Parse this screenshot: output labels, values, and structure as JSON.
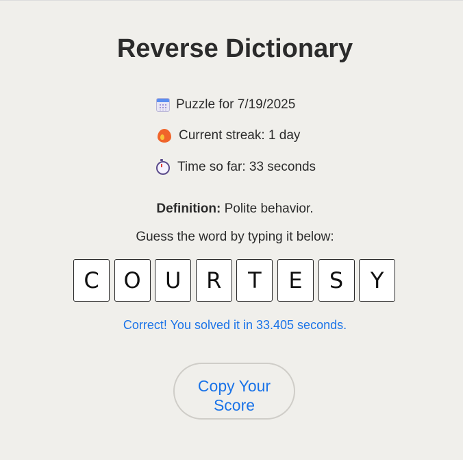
{
  "page": {
    "title": "Reverse Dictionary"
  },
  "info": {
    "date": {
      "icon": "calendar-icon",
      "text": "Puzzle for 7/19/2025"
    },
    "streak": {
      "icon": "fire-icon",
      "text": "Current streak: 1 day"
    },
    "time": {
      "icon": "stopwatch-icon",
      "text": "Time so far: 33 seconds"
    }
  },
  "definition": {
    "label": "Definition:",
    "text": " Polite behavior."
  },
  "guess_prompt": "Guess the word by typing it below:",
  "tiles": [
    "C",
    "O",
    "U",
    "R",
    "T",
    "E",
    "S",
    "Y"
  ],
  "result": "Correct! You solved it in 33.405 seconds.",
  "copy_button": "Copy Your Score",
  "colors": {
    "background": "#f0efeb",
    "accent": "#1a73e8",
    "text": "#2b2b2b"
  }
}
